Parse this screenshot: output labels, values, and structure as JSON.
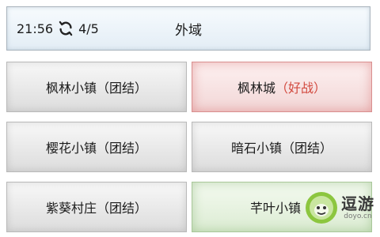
{
  "header": {
    "time": "21:56",
    "sync_icon": "refresh-icon",
    "count": "4/5",
    "title": "外域"
  },
  "zones": [
    {
      "name": "枫林小镇",
      "status": "（团结）",
      "kind": "neutral"
    },
    {
      "name": "枫林城",
      "status": "（好战）",
      "kind": "hostile",
      "status_color": "#d24a3f"
    },
    {
      "name": "樱花小镇",
      "status": "（团结）",
      "kind": "neutral"
    },
    {
      "name": "暗石小镇",
      "status": "（团结）",
      "kind": "neutral"
    },
    {
      "name": "紫葵村庄",
      "status": "（团结）",
      "kind": "neutral"
    },
    {
      "name": "芊叶小镇",
      "status": "（",
      "kind": "friendly",
      "status_color": "#5da34c"
    }
  ],
  "watermark": {
    "text": "逗游",
    "sub": "doyo.cn"
  }
}
